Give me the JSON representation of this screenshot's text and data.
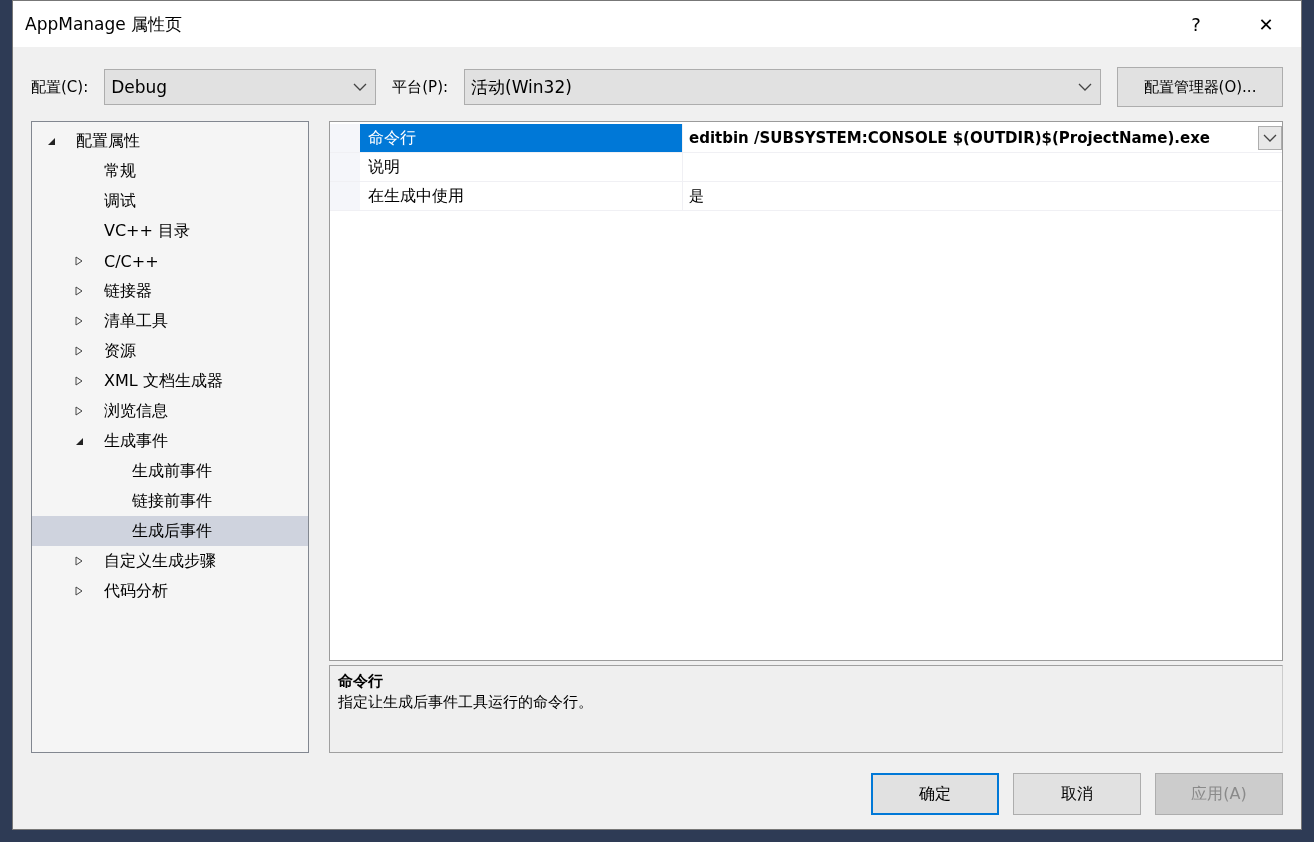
{
  "window": {
    "title": "AppManage 属性页",
    "help": "?",
    "close": "✕"
  },
  "config": {
    "label": "配置(C):",
    "value": "Debug"
  },
  "platform": {
    "label": "平台(P):",
    "value": "活动(Win32)"
  },
  "manager_button": "配置管理器(O)...",
  "tree": [
    {
      "label": "配置属性",
      "expanded": true,
      "selected": false,
      "children": [
        {
          "label": "常规",
          "selected": false
        },
        {
          "label": "调试",
          "selected": false
        },
        {
          "label": "VC++ 目录",
          "selected": false
        },
        {
          "label": "C/C++",
          "expanded": false,
          "selected": false
        },
        {
          "label": "链接器",
          "expanded": false,
          "selected": false
        },
        {
          "label": "清单工具",
          "expanded": false,
          "selected": false
        },
        {
          "label": "资源",
          "expanded": false,
          "selected": false
        },
        {
          "label": "XML 文档生成器",
          "expanded": false,
          "selected": false
        },
        {
          "label": "浏览信息",
          "expanded": false,
          "selected": false
        },
        {
          "label": "生成事件",
          "expanded": true,
          "selected": false,
          "children": [
            {
              "label": "生成前事件",
              "selected": false
            },
            {
              "label": "链接前事件",
              "selected": false
            },
            {
              "label": "生成后事件",
              "selected": true
            }
          ]
        },
        {
          "label": "自定义生成步骤",
          "expanded": false,
          "selected": false
        },
        {
          "label": "代码分析",
          "expanded": false,
          "selected": false
        }
      ]
    }
  ],
  "properties": [
    {
      "name": "命令行",
      "value": "editbin /SUBSYSTEM:CONSOLE $(OUTDIR)$(ProjectName).exe",
      "selected": true,
      "modified": true
    },
    {
      "name": "说明",
      "selected": false,
      "modified": false
    },
    {
      "name": "在生成中使用",
      "value": "是",
      "selected": false,
      "modified": false
    }
  ],
  "description": {
    "title": "命令行",
    "text": "指定让生成后事件工具运行的命令行。"
  },
  "buttons": [
    {
      "label": "确定",
      "default": true,
      "disabled": false
    },
    {
      "label": "取消",
      "default": false,
      "disabled": false
    },
    {
      "label": "应用(A)",
      "default": false,
      "disabled": true
    }
  ]
}
